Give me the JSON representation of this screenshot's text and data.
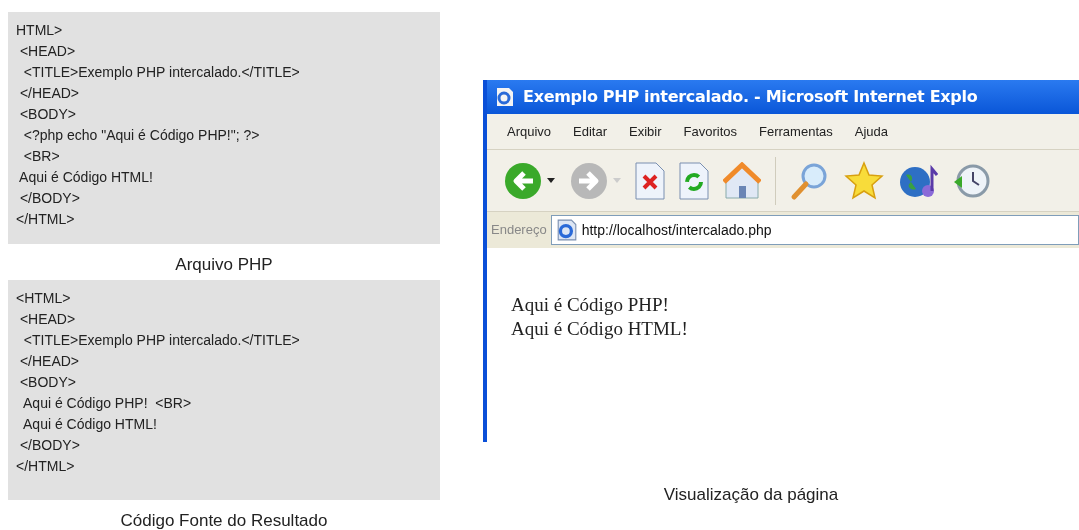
{
  "code_panels": [
    {
      "lines": [
        "HTML>",
        " <HEAD>",
        "  <TITLE>Exemplo PHP intercalado.</TITLE>",
        " </HEAD>",
        " <BODY>",
        "  <?php echo \"Aqui é Código PHP!\"; ?>",
        "  <BR>",
        " Aqui é Código HTML!",
        " </BODY>",
        "</HTML>"
      ],
      "caption": "Arquivo PHP"
    },
    {
      "lines": [
        "<HTML>",
        " <HEAD>",
        "  <TITLE>Exemplo PHP intercalado.</TITLE>",
        " </HEAD>",
        " <BODY>",
        "  Aqui é Código PHP!  <BR>",
        "  Aqui é Código HTML!",
        " </BODY>",
        "</HTML>"
      ],
      "caption": "Código Fonte do Resultado"
    }
  ],
  "browser": {
    "title": "Exemplo PHP intercalado. - Microsoft Internet Explo",
    "menu": [
      "Arquivo",
      "Editar",
      "Exibir",
      "Favoritos",
      "Ferramentas",
      "Ajuda"
    ],
    "toolbar": [
      {
        "kind": "back",
        "disabled": false
      },
      {
        "kind": "forward",
        "disabled": true
      },
      {
        "kind": "stop"
      },
      {
        "kind": "refresh"
      },
      {
        "kind": "home"
      },
      {
        "kind": "search"
      },
      {
        "kind": "favorites"
      },
      {
        "kind": "media"
      },
      {
        "kind": "history"
      }
    ],
    "address_label": "Endereço",
    "url": "http://localhost/intercalado.php",
    "content": [
      "Aqui é Código PHP!",
      "Aqui é Código HTML!"
    ],
    "caption": "Visualização da página"
  }
}
